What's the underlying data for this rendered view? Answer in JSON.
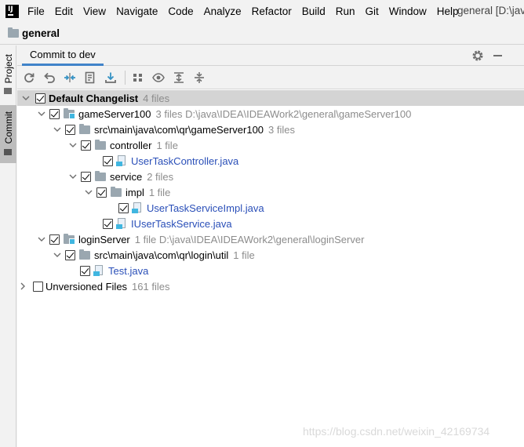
{
  "menubar": {
    "items": [
      "File",
      "Edit",
      "View",
      "Navigate",
      "Code",
      "Analyze",
      "Refactor",
      "Build",
      "Run",
      "Git",
      "Window",
      "Help"
    ],
    "window_title": "general [D:\\jav"
  },
  "navbar": {
    "project": "general"
  },
  "side_tabs": {
    "project": "Project",
    "commit": "Commit"
  },
  "toolwindow": {
    "tab": "Commit to dev"
  },
  "tree": {
    "changelist": {
      "label": "Default Changelist",
      "meta": "4 files"
    },
    "game_module": {
      "label": "gameServer100",
      "meta": "3 files  D:\\java\\IDEA\\IDEAWork2\\general\\gameServer100"
    },
    "game_src": {
      "label": "src\\main\\java\\com\\qr\\gameServer100",
      "meta": "3 files"
    },
    "controller": {
      "label": "controller",
      "meta": "1 file"
    },
    "controller_file": {
      "label": "UserTaskController.java"
    },
    "service": {
      "label": "service",
      "meta": "2 files"
    },
    "impl": {
      "label": "impl",
      "meta": "1 file"
    },
    "impl_file": {
      "label": "UserTaskServiceImpl.java"
    },
    "service_file": {
      "label": "IUserTaskService.java"
    },
    "login_module": {
      "label": "loginServer",
      "meta": "1 file  D:\\java\\IDEA\\IDEAWork2\\general\\loginServer"
    },
    "login_src": {
      "label": "src\\main\\java\\com\\qr\\login\\util",
      "meta": "1 file"
    },
    "test_file": {
      "label": "Test.java"
    },
    "unversioned": {
      "label": "Unversioned Files",
      "meta": "161 files"
    }
  },
  "watermark": "https://blog.csdn.net/weixin_42169734",
  "colors": {
    "accent": "#4083c9",
    "file_blue": "#2a4fb8",
    "selection": "#d4d4d4"
  }
}
